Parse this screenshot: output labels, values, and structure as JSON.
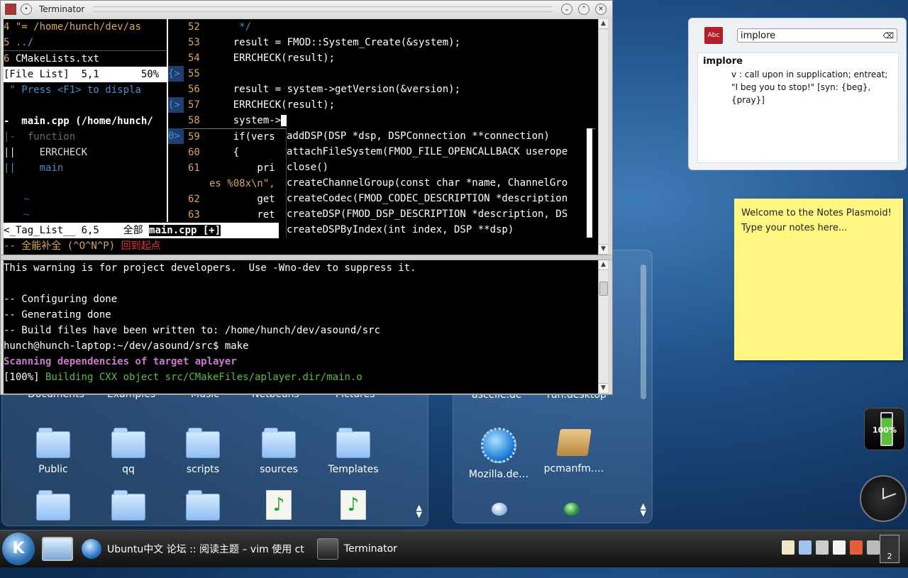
{
  "window": {
    "title": "Terminator"
  },
  "vim_left": {
    "lines": [
      {
        "num": "4",
        "text": " \"= /home/hunch/dev/as",
        "color": "#d7a65f"
      },
      {
        "num": "5",
        "text": " ../",
        "color": "#5aa0d6"
      },
      {
        "num": "6",
        "text": " CMakeLists.txt",
        "color": "#ffffff"
      }
    ],
    "statusline_top": "[File List]  5,1       50%",
    "help_text": " \" Press <F1> to displa",
    "tag_header": "-  main.cpp (/home/hunch/",
    "tags": [
      "|-  function",
      "||    ERRCHECK",
      "||    main"
    ],
    "tildes": [
      "~",
      "~"
    ],
    "statusline_bottom": "<_Tag_List__ 6,5    全部 ",
    "statusline_file": "main.cpp [+]",
    "mode_line": "-- 全能补全 (^O^N^P) ",
    "mode_line_red": "回到起点"
  },
  "vim_right": {
    "code": [
      {
        "num": "52",
        "text": "     */"
      },
      {
        "num": "53",
        "text": "    result = FMOD::System_Create(&system);"
      },
      {
        "num": "54",
        "text": "    ERRCHECK(result);"
      },
      {
        "num": "55",
        "text": ""
      },
      {
        "num": "56",
        "text": "    result = system->getVersion(&version);"
      },
      {
        "num": "57",
        "text": "    ERRCHECK(result);"
      },
      {
        "num": "58",
        "text": "    system->"
      },
      {
        "num": "59",
        "text": "    if(vers"
      },
      {
        "num": "60",
        "text": "    {"
      },
      {
        "num": "61",
        "text": "        pri"
      },
      {
        "num": "",
        "text": "es %08x\\n\","
      },
      {
        "num": "62",
        "text": "        get"
      },
      {
        "num": "63",
        "text": "        ret"
      }
    ],
    "completion": [
      "addDSP(DSP *dsp, DSPConnection **connection)",
      "attachFileSystem(FMOD_FILE_OPENCALLBACK userope",
      "close()",
      "createChannelGroup(const char *name, ChannelGro",
      "createCodec(FMOD_CODEC_DESCRIPTION *description",
      "createDSP(FMOD_DSP_DESCRIPTION *description, DS",
      "createDSPByIndex(int index, DSP **dsp)"
    ]
  },
  "terminal": {
    "lines": [
      {
        "text": "This warning is for project developers.  Use -Wno-dev to suppress it.",
        "color": "#ffffff"
      },
      {
        "text": "",
        "color": "#ffffff"
      },
      {
        "text": "-- Configuring done",
        "color": "#ffffff"
      },
      {
        "text": "-- Generating done",
        "color": "#ffffff"
      },
      {
        "text": "-- Build files have been written to: /home/hunch/dev/asound/src",
        "color": "#ffffff"
      },
      {
        "text": "hunch@hunch-laptop:~/dev/asound/src$ make",
        "color": "#ffffff"
      }
    ],
    "scan_line": "Scanning dependencies of target aplayer",
    "build_prefix": "[100%] ",
    "build_text": "Building CXX object src/CMakeFiles/aplayer.dir/main.o"
  },
  "folder_left": {
    "top_labels": [
      "Documents",
      "Examples",
      "Music",
      "Netbeans",
      "Pictures"
    ],
    "row_labels": [
      "Public",
      "qq",
      "scripts",
      "sources",
      "Templates"
    ]
  },
  "folder_right": {
    "top_labels": [
      "ascelle.de",
      "run.desktop"
    ],
    "row_labels": [
      "Mozilla.de…",
      "pcmanfm.…"
    ]
  },
  "dictionary": {
    "query": "implore",
    "word": "implore",
    "definition": "v : call upon in supplication; entreat; \"I beg you to stop!\" [syn: {beg}, {pray}]"
  },
  "notes": {
    "text_line1": "Welcome to the Notes Plasmoid!",
    "text_line2": "Type your notes here..."
  },
  "battery": {
    "label": "100%"
  },
  "taskbar": {
    "tasks": [
      {
        "label": "Ubuntu中文 论坛 :: 阅读主题 – vim 使用 ct"
      },
      {
        "label": "Terminator"
      }
    ],
    "pager": "2"
  }
}
